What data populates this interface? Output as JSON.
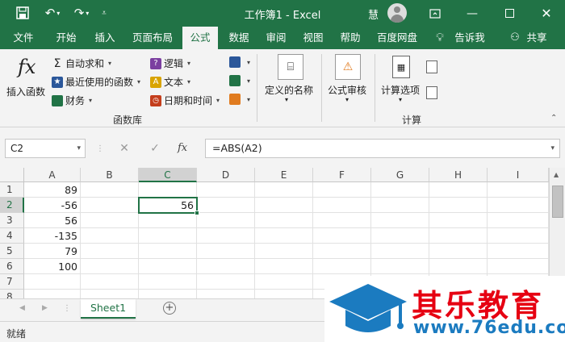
{
  "titlebar": {
    "title": "工作簿1  -  Excel",
    "user": "慧",
    "bg_color": "#217346"
  },
  "tabs": [
    {
      "label": "文件"
    },
    {
      "label": "开始"
    },
    {
      "label": "插入"
    },
    {
      "label": "页面布局"
    },
    {
      "label": "公式",
      "active": true
    },
    {
      "label": "数据"
    },
    {
      "label": "审阅"
    },
    {
      "label": "视图"
    },
    {
      "label": "帮助"
    },
    {
      "label": "百度网盘"
    },
    {
      "label": "告诉我"
    },
    {
      "label": "共享"
    }
  ],
  "ribbon": {
    "insert_function": "插入函数",
    "autosum": "自动求和",
    "recent": "最近使用的函数",
    "financial": "财务",
    "logical": "逻辑",
    "text": "文本",
    "datetime": "日期和时间",
    "group_library": "函数库",
    "defined_names": "定义的名称",
    "formula_auditing": "公式审核",
    "calc_options": "计算选项",
    "group_calc": "计算"
  },
  "formula_bar": {
    "name_box": "C2",
    "fx": "fx",
    "formula": "=ABS(A2)"
  },
  "grid": {
    "columns": [
      "A",
      "B",
      "C",
      "D",
      "E",
      "F",
      "G",
      "H",
      "I"
    ],
    "selected_column": "C",
    "rows": [
      "1",
      "2",
      "3",
      "4",
      "5",
      "6",
      "7",
      "8"
    ],
    "selected_row": "2",
    "col_a_values": [
      "89",
      "-56",
      "56",
      "-135",
      "79",
      "100"
    ],
    "active_cell_value": "56"
  },
  "sheets": {
    "tab": "Sheet1"
  },
  "status": {
    "text": "就绪"
  },
  "watermark": {
    "title": "其乐教育",
    "url": "www.76edu.com"
  }
}
